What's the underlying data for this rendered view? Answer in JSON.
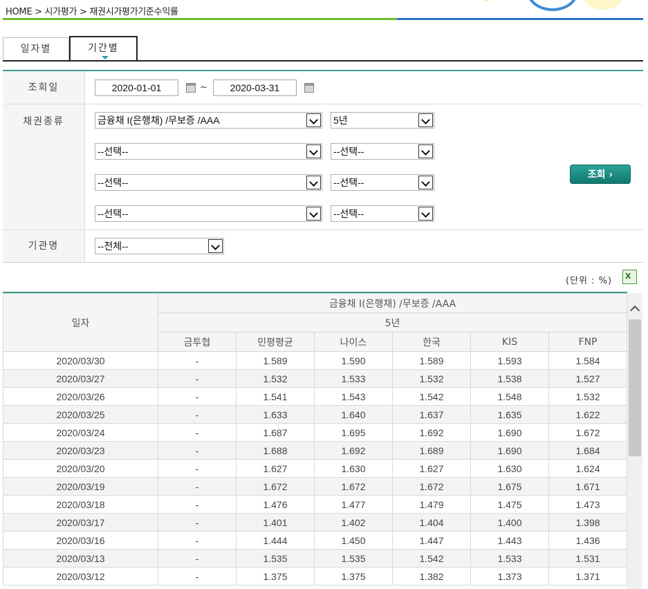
{
  "breadcrumb": "HOME > 시가평가 > 채권시가평가기준수익률",
  "tabs": [
    {
      "label": "일자별",
      "active": false
    },
    {
      "label": "기간별",
      "active": true
    }
  ],
  "form": {
    "date_label": "조회일",
    "date_from": "2020-01-01",
    "date_to": "2020-03-31",
    "date_sep": "~",
    "bond_label": "채권종류",
    "bond_rows": [
      {
        "type": "금융채 I(은행채) /무보증 /AAA",
        "term": "5년"
      },
      {
        "type": "--선택--",
        "term": "--선택--"
      },
      {
        "type": "--선택--",
        "term": "--선택--"
      },
      {
        "type": "--선택--",
        "term": "--선택--"
      }
    ],
    "org_label": "기관명",
    "org_value": "--전체--",
    "search_button": "조회 ›"
  },
  "unit_label": "(단위 : %)",
  "excel_label": "X",
  "table": {
    "date_header": "일자",
    "group_header": "금융채 I(은행채) /무보증 /AAA",
    "term_header": "5년",
    "columns": [
      "금투협",
      "민평평균",
      "나이스",
      "한국",
      "KIS",
      "FNP"
    ],
    "rows": [
      [
        "2020/03/30",
        "-",
        "1.589",
        "1.590",
        "1.589",
        "1.593",
        "1.584"
      ],
      [
        "2020/03/27",
        "-",
        "1.532",
        "1.533",
        "1.532",
        "1.538",
        "1.527"
      ],
      [
        "2020/03/26",
        "-",
        "1.541",
        "1.543",
        "1.542",
        "1.548",
        "1.532"
      ],
      [
        "2020/03/25",
        "-",
        "1.633",
        "1.640",
        "1.637",
        "1.635",
        "1.622"
      ],
      [
        "2020/03/24",
        "-",
        "1.687",
        "1.695",
        "1.692",
        "1.690",
        "1.672"
      ],
      [
        "2020/03/23",
        "-",
        "1.688",
        "1.692",
        "1.689",
        "1.690",
        "1.684"
      ],
      [
        "2020/03/20",
        "-",
        "1.627",
        "1.630",
        "1.627",
        "1.630",
        "1.624"
      ],
      [
        "2020/03/19",
        "-",
        "1.672",
        "1.672",
        "1.672",
        "1.675",
        "1.671"
      ],
      [
        "2020/03/18",
        "-",
        "1.476",
        "1.477",
        "1.479",
        "1.475",
        "1.473"
      ],
      [
        "2020/03/17",
        "-",
        "1.401",
        "1.402",
        "1.404",
        "1.400",
        "1.398"
      ],
      [
        "2020/03/16",
        "-",
        "1.444",
        "1.450",
        "1.447",
        "1.443",
        "1.436"
      ],
      [
        "2020/03/13",
        "-",
        "1.535",
        "1.535",
        "1.542",
        "1.533",
        "1.531"
      ],
      [
        "2020/03/12",
        "-",
        "1.375",
        "1.375",
        "1.382",
        "1.373",
        "1.371"
      ]
    ]
  },
  "colors": {
    "accent_green": "#6fba2c",
    "accent_blue": "#2a73c4",
    "teal": "#3d9b8c",
    "button": "#11786f"
  }
}
